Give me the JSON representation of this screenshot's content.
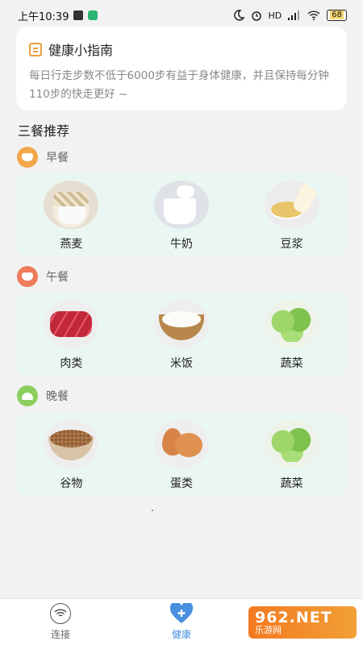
{
  "status_bar": {
    "time": "上午10:39",
    "network": "HD",
    "battery": "68"
  },
  "tip": {
    "title": "健康小指南",
    "body": "每日行走步数不低于6000步有益于身体健康，并且保持每分钟110步的快走更好 ~"
  },
  "section_title": "三餐推荐",
  "meals": [
    {
      "name": "早餐",
      "foods": [
        {
          "label": "燕麦",
          "icon": "oats-image"
        },
        {
          "label": "牛奶",
          "icon": "milk-image"
        },
        {
          "label": "豆浆",
          "icon": "soymilk-image"
        }
      ]
    },
    {
      "name": "午餐",
      "foods": [
        {
          "label": "肉类",
          "icon": "meat-image"
        },
        {
          "label": "米饭",
          "icon": "rice-image"
        },
        {
          "label": "蔬菜",
          "icon": "vegetable-image"
        }
      ]
    },
    {
      "name": "晚餐",
      "foods": [
        {
          "label": "谷物",
          "icon": "grain-image"
        },
        {
          "label": "蛋类",
          "icon": "egg-image"
        },
        {
          "label": "蔬菜",
          "icon": "vegetable-image"
        }
      ]
    }
  ],
  "bottom_nav": {
    "items": [
      {
        "label": "连接",
        "icon": "wifi-icon",
        "active": false
      },
      {
        "label": "健康",
        "icon": "heart-plus-icon",
        "active": true
      }
    ]
  },
  "watermark": {
    "top": "962.NET",
    "bottom": "乐游网"
  },
  "colors": {
    "accent": "#4a8fe0",
    "breakfast": "#f3a64a",
    "lunch": "#ef7b5b",
    "dinner": "#8ccf5e",
    "card_bg": "#eaf6f1"
  }
}
